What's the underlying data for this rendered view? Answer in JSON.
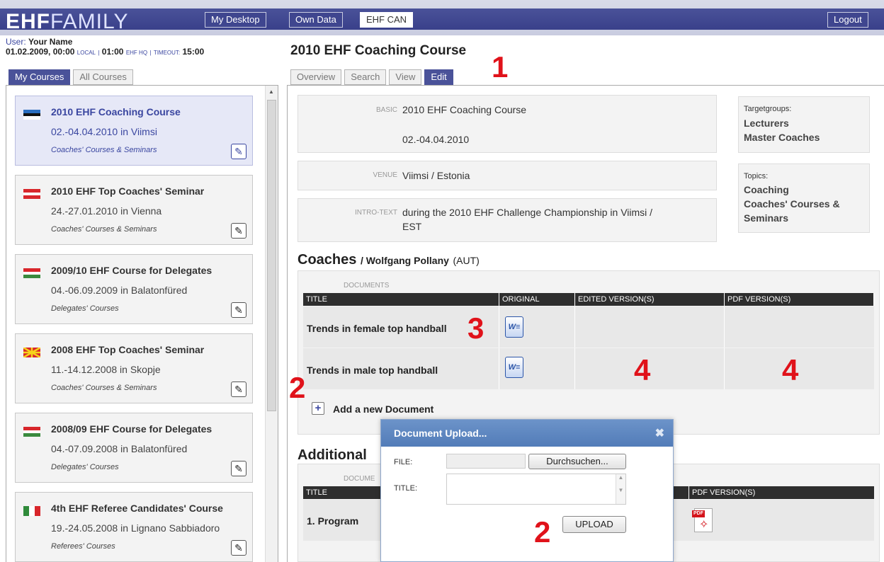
{
  "header": {
    "logo_bold": "EHF",
    "logo_light": "FAMILY",
    "nav": [
      {
        "label": "My Desktop"
      },
      {
        "label": "Own Data"
      },
      {
        "label": "EHF CAN"
      }
    ],
    "logout": "Logout"
  },
  "user": {
    "label": "User:",
    "name": "Your Name",
    "datetime": "01.02.2009, 00:00",
    "local": "LOCAL",
    "separator": "|",
    "hq_time": "01:00",
    "hq_label": "EHF HQ",
    "timeout_label": "TIMEOUT:",
    "timeout": "15:00"
  },
  "left_tabs": [
    {
      "label": "My Courses"
    },
    {
      "label": "All Courses"
    }
  ],
  "courses": [
    {
      "title": "2010 EHF Coaching Course",
      "date": "02.-04.04.2010 in Viimsi",
      "category": "Coaches' Courses & Seminars",
      "flag": "estonia"
    },
    {
      "title": "2010 EHF Top Coaches' Seminar",
      "date": "24.-27.01.2010 in Vienna",
      "category": "Coaches' Courses & Seminars",
      "flag": "austria"
    },
    {
      "title": "2009/10 EHF Course for Delegates",
      "date": "04.-06.09.2009 in Balatonfüred",
      "category": "Delegates' Courses",
      "flag": "hungary"
    },
    {
      "title": "2008 EHF Top Coaches' Seminar",
      "date": "11.-14.12.2008 in Skopje",
      "category": "Coaches' Courses & Seminars",
      "flag": "macedonia"
    },
    {
      "title": "2008/09 EHF Course for Delegates",
      "date": "04.-07.09.2008 in Balatonfüred",
      "category": "Delegates' Courses",
      "flag": "hungary"
    },
    {
      "title": "4th EHF Referee Candidates' Course",
      "date": "19.-24.05.2008 in Lignano Sabbiadoro",
      "category": "Referees' Courses",
      "flag": "italy"
    }
  ],
  "main": {
    "title": "2010 EHF Coaching Course",
    "tabs": [
      {
        "label": "Overview"
      },
      {
        "label": "Search"
      },
      {
        "label": "View"
      },
      {
        "label": "Edit"
      }
    ],
    "basic_label": "BASIC",
    "basic_title": "2010 EHF Coaching Course",
    "basic_date": "02.-04.04.2010",
    "venue_label": "VENUE",
    "venue": "Viimsi / Estonia",
    "intro_label": "INTRO-TEXT",
    "intro_line1": "during the 2010 EHF Challenge Championship in Viimsi /",
    "intro_line2": "EST",
    "targetgroups_label": "Targetgroups:",
    "targetgroups": [
      "Lecturers",
      "Master Coaches"
    ],
    "topics_label": "Topics:",
    "topics": [
      "Coaching",
      "Coaches' Courses &",
      "Seminars"
    ]
  },
  "coaches": {
    "heading": "Coaches",
    "slash_name": "/ Wolfgang Pollany",
    "country": "(AUT)",
    "documents_label": "DOCUMENTS",
    "columns": [
      "TITLE",
      "ORIGINAL",
      "EDITED VERSION(S)",
      "PDF VERSION(S)"
    ],
    "rows": [
      {
        "title": "Trends in female top handball"
      },
      {
        "title": "Trends in male top handball"
      }
    ],
    "add_label": "Add a new Document"
  },
  "additional": {
    "heading": "Additional",
    "documents_label": "DOCUME",
    "title_col": "TITLE",
    "pdf_col": "PDF VERSION(S)",
    "row_title": "1. Program"
  },
  "dialog": {
    "title": "Document Upload...",
    "file_label": "FILE:",
    "browse": "Durchsuchen...",
    "title_label": "TITLE:",
    "upload": "UPLOAD"
  },
  "markers": {
    "m1": "1",
    "m2a": "2",
    "m2b": "2",
    "m3": "3",
    "m4a": "4",
    "m4b": "4"
  },
  "icons": {
    "word": "word-document-icon",
    "pdf": "pdf-document-icon",
    "edit": "pencil-icon",
    "close": "close-icon",
    "add": "plus-icon"
  },
  "colors": {
    "nav_bg": "#4a5299",
    "accent": "#3a46a0",
    "marker": "#e0121a",
    "dialog_head": "#6c93c9"
  }
}
